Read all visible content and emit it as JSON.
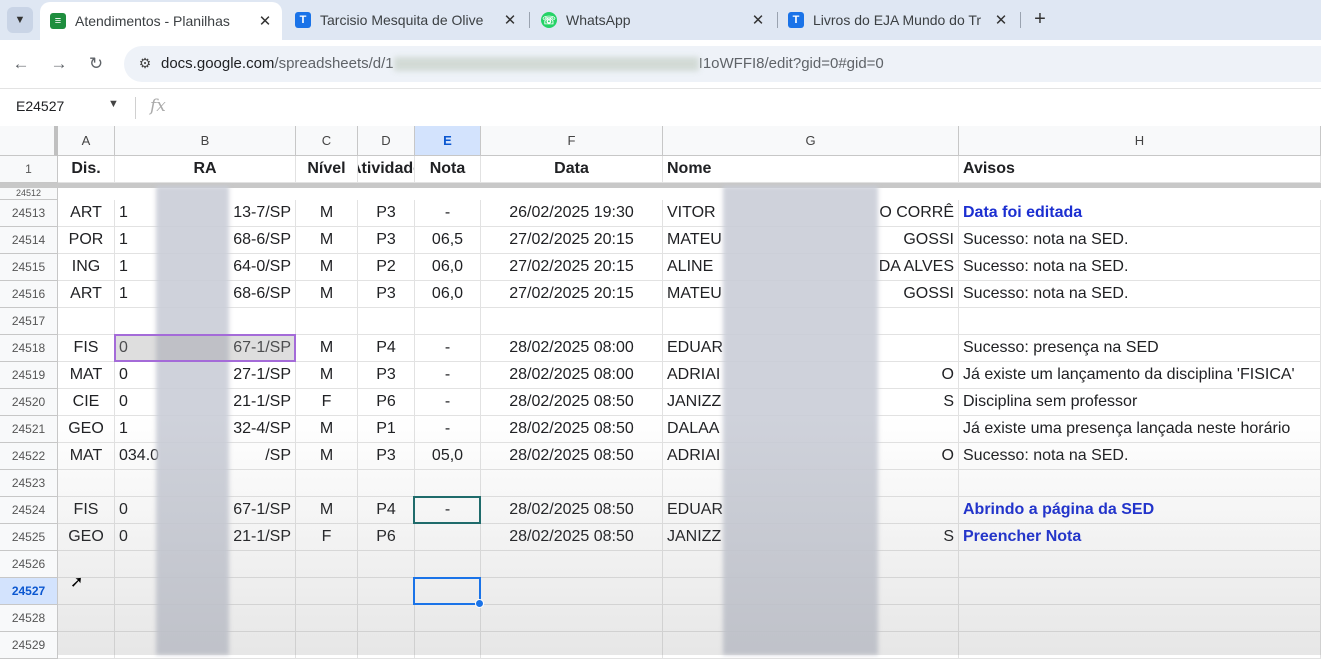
{
  "browser": {
    "tabs": [
      {
        "title": "Atendimentos - Planilhas",
        "icon": "sheets-icon",
        "active": true
      },
      {
        "title": "Tarcisio Mesquita de Olive",
        "icon": "t-icon",
        "active": false
      },
      {
        "title": "WhatsApp",
        "icon": "whatsapp-icon",
        "active": false
      },
      {
        "title": "Livros do EJA Mundo do Tr",
        "icon": "t-icon",
        "active": false
      }
    ],
    "url_prefix": "docs.google.com",
    "url_path_start": "/spreadsheets/d/1",
    "url_tail": "I1oWFFI8/edit?gid=0#gid=0",
    "new_tab": "+",
    "close": "✕"
  },
  "formula_bar": {
    "name_box": "E24527",
    "fx": "fx",
    "formula": ""
  },
  "columns": [
    {
      "letter": "A",
      "header": "Dis."
    },
    {
      "letter": "B",
      "header": "RA"
    },
    {
      "letter": "C",
      "header": "Nível"
    },
    {
      "letter": "D",
      "header": "Atividade"
    },
    {
      "letter": "E",
      "header": "Nota",
      "selected": true
    },
    {
      "letter": "F",
      "header": "Data"
    },
    {
      "letter": "G",
      "header": "Nome"
    },
    {
      "letter": "H",
      "header": "Avisos"
    }
  ],
  "header_row_number": "1",
  "partial_row_number": "24512",
  "rows": [
    {
      "n": "24513",
      "dis": "ART",
      "ra_start": "1",
      "ra_end": "13-7/SP",
      "nivel": "M",
      "ativ": "P3",
      "nota": "-",
      "data": "26/02/2025 19:30",
      "nome_start": "VITOR",
      "nome_end": "O CORRÊ",
      "aviso": "Data foi editada",
      "aviso_style": "bluebold"
    },
    {
      "n": "24514",
      "dis": "POR",
      "ra_start": "1",
      "ra_end": "68-6/SP",
      "nivel": "M",
      "ativ": "P3",
      "nota": "06,5",
      "data": "27/02/2025 20:15",
      "nome_start": "MATEU",
      "nome_end": "GOSSI",
      "aviso": "Sucesso: nota na SED."
    },
    {
      "n": "24515",
      "dis": "ING",
      "ra_start": "1",
      "ra_end": "64-0/SP",
      "nivel": "M",
      "ativ": "P2",
      "nota": "06,0",
      "data": "27/02/2025 20:15",
      "nome_start": "ALINE",
      "nome_end": "DA ALVES",
      "aviso": "Sucesso: nota na SED."
    },
    {
      "n": "24516",
      "dis": "ART",
      "ra_start": "1",
      "ra_end": "68-6/SP",
      "nivel": "M",
      "ativ": "P3",
      "nota": "06,0",
      "data": "27/02/2025 20:15",
      "nome_start": "MATEU",
      "nome_end": "GOSSI",
      "aviso": "Sucesso: nota na SED."
    },
    {
      "n": "24517",
      "dis": "",
      "ra_start": "",
      "ra_end": "",
      "nivel": "",
      "ativ": "",
      "nota": "",
      "data": "",
      "nome_start": "",
      "nome_end": "",
      "aviso": ""
    },
    {
      "n": "24518",
      "dis": "FIS",
      "ra_start": "0",
      "ra_end": "67-1/SP",
      "nivel": "M",
      "ativ": "P4",
      "nota": "-",
      "data": "28/02/2025 08:00",
      "nome_start": "EDUAR",
      "nome_end": "",
      "aviso": "Sucesso: presença na SED"
    },
    {
      "n": "24519",
      "dis": "MAT",
      "ra_start": "0",
      "ra_end": "27-1/SP",
      "nivel": "M",
      "ativ": "P3",
      "nota": "-",
      "data": "28/02/2025 08:00",
      "nome_start": "ADRIAI",
      "nome_end": "O",
      "aviso": "Já existe um lançamento da disciplina 'FISICA'"
    },
    {
      "n": "24520",
      "dis": "CIE",
      "ra_start": "0",
      "ra_end": "21-1/SP",
      "nivel": "F",
      "ativ": "P6",
      "nota": "-",
      "data": "28/02/2025 08:50",
      "nome_start": "JANIZZ",
      "nome_end": "S",
      "aviso": "Disciplina sem professor"
    },
    {
      "n": "24521",
      "dis": "GEO",
      "ra_start": "1",
      "ra_end": "32-4/SP",
      "nivel": "M",
      "ativ": "P1",
      "nota": "-",
      "data": "28/02/2025 08:50",
      "nome_start": "DALAA",
      "nome_end": "",
      "aviso": "Já existe uma presença lançada neste horário"
    },
    {
      "n": "24522",
      "dis": "MAT",
      "ra_start": "034.0",
      "ra_end": "/SP",
      "nivel": "M",
      "ativ": "P3",
      "nota": "05,0",
      "data": "28/02/2025 08:50",
      "nome_start": "ADRIAI",
      "nome_end": "O",
      "aviso": "Sucesso: nota na SED."
    },
    {
      "n": "24523",
      "dis": "",
      "ra_start": "",
      "ra_end": "",
      "nivel": "",
      "ativ": "",
      "nota": "",
      "data": "",
      "nome_start": "",
      "nome_end": "",
      "aviso": ""
    },
    {
      "n": "24524",
      "dis": "FIS",
      "ra_start": "0",
      "ra_end": "67-1/SP",
      "nivel": "M",
      "ativ": "P4",
      "nota": "-",
      "data": "28/02/2025 08:50",
      "nome_start": "EDUAR",
      "nome_end": "",
      "aviso": "Abrindo a página da SED",
      "aviso_style": "bluebold"
    },
    {
      "n": "24525",
      "dis": "GEO",
      "ra_start": "0",
      "ra_end": "21-1/SP",
      "nivel": "F",
      "ativ": "P6",
      "nota": "",
      "data": "28/02/2025 08:50",
      "nome_start": "JANIZZ",
      "nome_end": "S",
      "aviso": "Preencher Nota",
      "aviso_style": "bluebold"
    },
    {
      "n": "24526",
      "dis": "",
      "ra_start": "",
      "ra_end": "",
      "nivel": "",
      "ativ": "",
      "nota": "",
      "data": "",
      "nome_start": "",
      "nome_end": "",
      "aviso": ""
    },
    {
      "n": "24527",
      "selected": true,
      "dis": "",
      "ra_start": "",
      "ra_end": "",
      "nivel": "",
      "ativ": "",
      "nota": "",
      "data": "",
      "nome_start": "",
      "nome_end": "",
      "aviso": ""
    },
    {
      "n": "24528",
      "dis": "",
      "ra_start": "",
      "ra_end": "",
      "nivel": "",
      "ativ": "",
      "nota": "",
      "data": "",
      "nome_start": "",
      "nome_end": "",
      "aviso": ""
    },
    {
      "n": "24529",
      "dis": "",
      "ra_start": "",
      "ra_end": "",
      "nivel": "",
      "ativ": "",
      "nota": "",
      "data": "",
      "nome_start": "",
      "nome_end": "",
      "aviso": ""
    }
  ],
  "colors": {
    "accent": "#1a73e8",
    "selected_header": "#d3e3fd",
    "warning_text": "#1c2fd1",
    "selection_range": "#a46bd8"
  }
}
